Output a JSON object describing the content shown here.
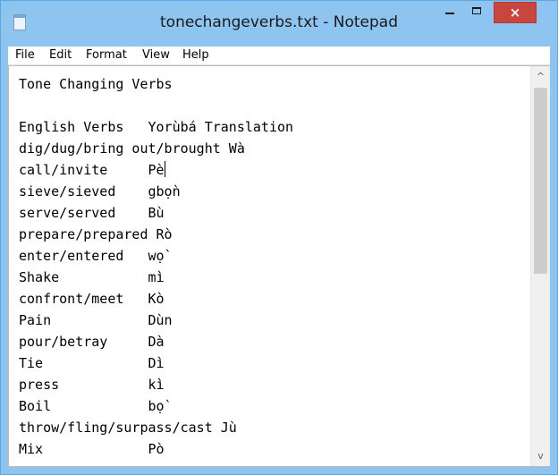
{
  "window": {
    "title": "tonechangeverbs.txt - Notepad",
    "close_glyph": "×",
    "accent_color": "#8ec4f0",
    "close_color": "#c9463d"
  },
  "menu": [
    "File",
    "Edit",
    "Format",
    "View",
    "Help"
  ],
  "document": {
    "lines": [
      "Tone Changing Verbs",
      "",
      "English Verbs   Yorùbá Translation",
      "dig/dug/bring out/brought Wà",
      "call/invite     Pè",
      "sieve/sieved    gbọ̀n",
      "serve/served    Bù",
      "prepare/prepared Rò",
      "enter/entered   wọ̀",
      "Shake           mì",
      "confront/meet   Kò",
      "Pain            Dùn",
      "pour/betray     Dà",
      "Tie             Dì",
      "press           kì",
      "Boil            bọ̀",
      "throw/fling/surpass/cast Jù",
      "Mix             Pò"
    ]
  },
  "scrollbar": {
    "up_glyph": "^",
    "down_glyph": "v",
    "position_fraction": 0.0
  }
}
